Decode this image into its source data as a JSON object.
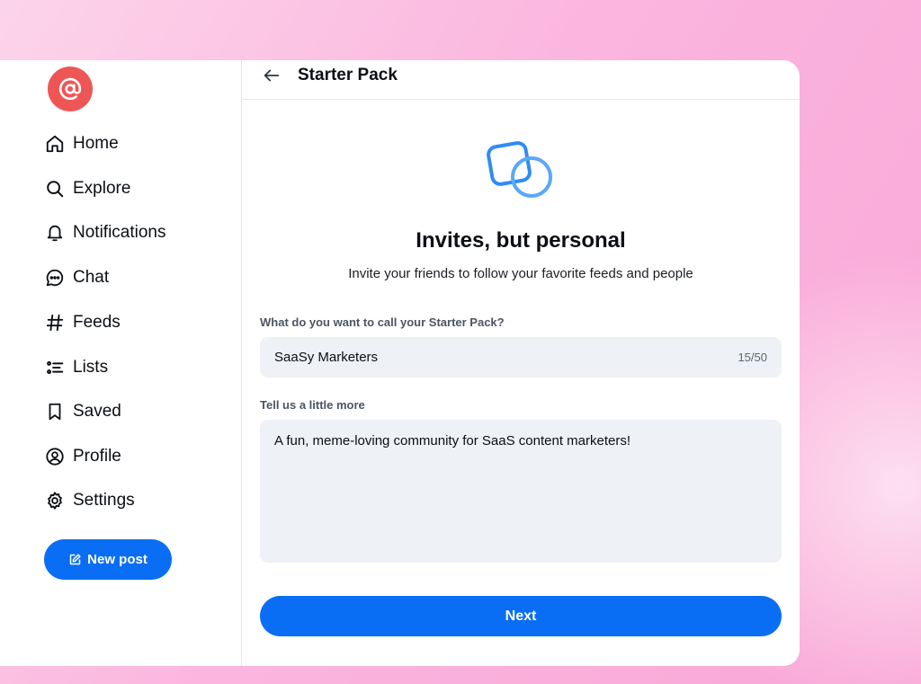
{
  "sidebar": {
    "logo_icon": "at-sign-icon",
    "items": [
      {
        "label": "Home",
        "icon": "home-icon"
      },
      {
        "label": "Explore",
        "icon": "search-icon"
      },
      {
        "label": "Notifications",
        "icon": "bell-icon"
      },
      {
        "label": "Chat",
        "icon": "chat-bubble-icon"
      },
      {
        "label": "Feeds",
        "icon": "hashtag-icon"
      },
      {
        "label": "Lists",
        "icon": "list-icon"
      },
      {
        "label": "Saved",
        "icon": "bookmark-icon"
      },
      {
        "label": "Profile",
        "icon": "user-circle-icon"
      },
      {
        "label": "Settings",
        "icon": "gear-icon"
      }
    ],
    "new_post_label": "New post",
    "new_post_icon": "edit-icon"
  },
  "header": {
    "back_icon": "arrow-left-icon",
    "title": "Starter Pack"
  },
  "hero": {
    "icon": "starter-pack-icon",
    "title": "Invites, but personal",
    "subtitle": "Invite your friends to follow your favorite feeds and people"
  },
  "form": {
    "name_label": "What do you want to call your Starter Pack?",
    "name_value": "SaaSy Marketers",
    "name_counter": "15/50",
    "description_label": "Tell us a little more",
    "description_value": "A fun, meme-loving community for SaaS content marketers!",
    "next_label": "Next"
  },
  "colors": {
    "accent": "#0a6ef5",
    "logo": "#ee5656",
    "input_bg": "#eef1f5",
    "background": "#f9a6d6"
  }
}
